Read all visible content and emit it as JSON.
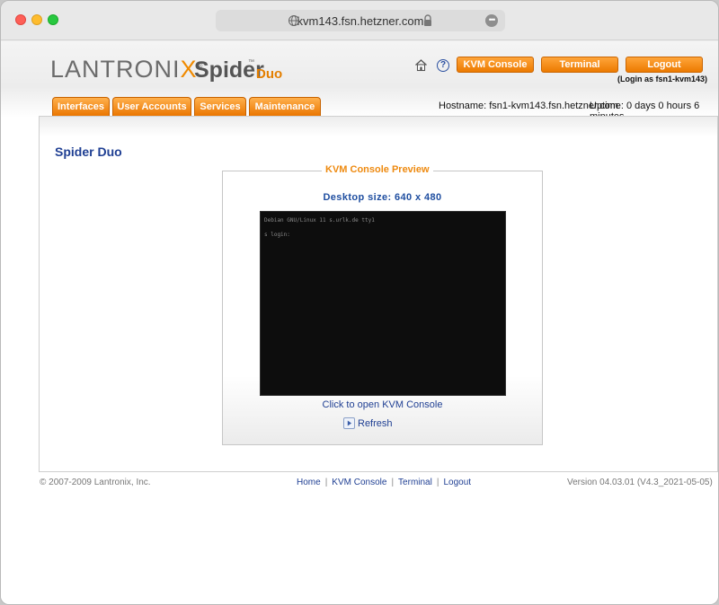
{
  "browser": {
    "url": "kvm143.fsn.hetzner.com"
  },
  "logo": {
    "lantronix": "LANTRONI",
    "lantronix_x": "X",
    "registered": "®",
    "spider": "Spider",
    "trademark": "™",
    "duo": "Duo"
  },
  "header": {
    "buttons": [
      "KVM Console",
      "Terminal",
      "Logout"
    ],
    "login_as": "(Login as fsn1-kvm143)",
    "icons": [
      "home-icon",
      "help-icon"
    ]
  },
  "tabs": [
    "Interfaces",
    "User Accounts",
    "Services",
    "Maintenance"
  ],
  "status": {
    "hostname": "Hostname: fsn1-kvm143.fsn.hetzner.com",
    "uptime": "Uptime: 0 days 0 hours 6 minutes"
  },
  "main": {
    "title": "Spider Duo",
    "preview_legend": "KVM Console Preview",
    "desktop_size": "Desktop size: 640 x 480",
    "console_lines": [
      "Debian GNU/Linux 11 s.urlk.de tty1",
      "s login:"
    ],
    "open_link": "Click to open KVM Console",
    "refresh": "Refresh"
  },
  "footer": {
    "copyright": "© 2007-2009 Lantronix, Inc.",
    "links": [
      "Home",
      "KVM Console",
      "Terminal",
      "Logout"
    ],
    "separator": "|",
    "version": "Version 04.03.01 (V4.3_2021-05-05)"
  },
  "colors": {
    "accent_orange": "#ec7a00",
    "link_blue": "#1f3f93"
  }
}
